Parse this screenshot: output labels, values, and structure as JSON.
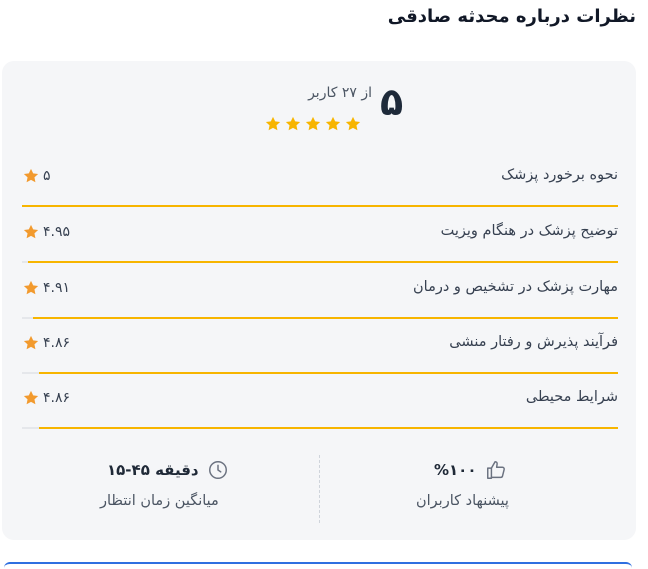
{
  "page": {
    "title": "نظرات درباره محدثه صادقی"
  },
  "summary": {
    "score": "۵",
    "count_text": "از ۲۷ کاربر",
    "stars_filled": 5,
    "stars_total": 5,
    "star_color": "#f7b500"
  },
  "criteria": [
    {
      "label": "نحوه برخورد پزشک",
      "score_text": "۵",
      "score": 5.0
    },
    {
      "label": "توضیح پزشک در هنگام ویزیت",
      "score_text": "۴.۹۵",
      "score": 4.95
    },
    {
      "label": "مهارت پزشک در تشخیص و درمان",
      "score_text": "۴.۹۱",
      "score": 4.91
    },
    {
      "label": "فرآیند پذیرش و رفتار منشی",
      "score_text": "۴.۸۶",
      "score": 4.86
    },
    {
      "label": "شرایط محیطی",
      "score_text": "۴.۸۶",
      "score": 4.86
    }
  ],
  "stats": {
    "recommend": {
      "value": "%۱۰۰",
      "label": "پیشنهاد کاربران",
      "icon": "thumbs-up-icon"
    },
    "wait": {
      "value": "۱۵-۴۵ دقیقه",
      "label": "میانگین زمان انتظار",
      "icon": "clock-icon"
    }
  },
  "colors": {
    "accent": "#f7b500",
    "score_star": "#f29a2e",
    "card_bg": "#f5f6f8",
    "bottom_accent": "#2f6fe0"
  }
}
